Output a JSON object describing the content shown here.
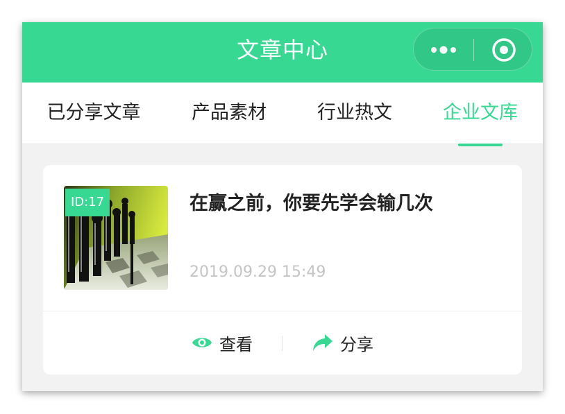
{
  "navbar": {
    "title": "文章中心",
    "more_icon": "more-dots-icon",
    "close_icon": "target-circle-icon",
    "color": "#36d892"
  },
  "tabs": [
    {
      "label": "已分享文章",
      "active": false
    },
    {
      "label": "产品素材",
      "active": false
    },
    {
      "label": "行业热文",
      "active": false
    },
    {
      "label": "企业文库",
      "active": true
    }
  ],
  "article": {
    "id_badge": "ID:17",
    "title": "在赢之前，你要先学会输几次",
    "time": "2019.09.29 15:49",
    "actions": {
      "view_label": "查看",
      "view_icon": "eye-icon",
      "share_label": "分享",
      "share_icon": "share-arrow-icon"
    }
  },
  "colors": {
    "accent": "#36d892",
    "text": "#222222",
    "muted": "#c4c4c4",
    "background": "#f2f2f2"
  }
}
